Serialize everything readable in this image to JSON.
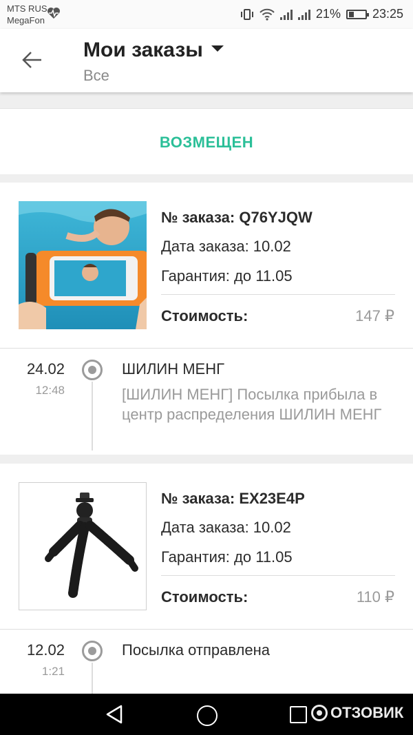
{
  "status_bar": {
    "carrier_1": "MTS RUS",
    "carrier_2": "MegaFon",
    "battery": "21%",
    "time": "23:25"
  },
  "app_bar": {
    "title": "Мои заказы",
    "subtitle": "Все"
  },
  "refund": {
    "label": "ВОЗМЕЩЕН"
  },
  "orders": [
    {
      "order_no": "№ заказа: Q76YJQW",
      "order_date": "Дата заказа: 10.02",
      "warranty": "Гарантия: до 11.05",
      "cost_label": "Стоимость:",
      "cost_value": "147 ₽",
      "image": "waterproof-phone-case-photo",
      "tracking": {
        "date": "24.02",
        "time": "12:48",
        "title": "ШИЛИН МЕНГ",
        "desc": "[ШИЛИН МЕНГ] Посылка прибыла в центр распределения ШИЛИН МЕНГ"
      }
    },
    {
      "order_no": "№ заказа: EX23E4P",
      "order_date": "Дата заказа: 10.02",
      "warranty": "Гарантия: до 11.05",
      "cost_label": "Стоимость:",
      "cost_value": "110 ₽",
      "image": "flexible-tripod-photo",
      "tracking": {
        "date": "12.02",
        "time": "1:21",
        "title": "Посылка отправлена"
      }
    }
  ],
  "watermark": "ОТЗОВИК",
  "colors": {
    "accent": "#2bbf98",
    "background": "#efefef",
    "muted_text": "#9a9a9a"
  }
}
